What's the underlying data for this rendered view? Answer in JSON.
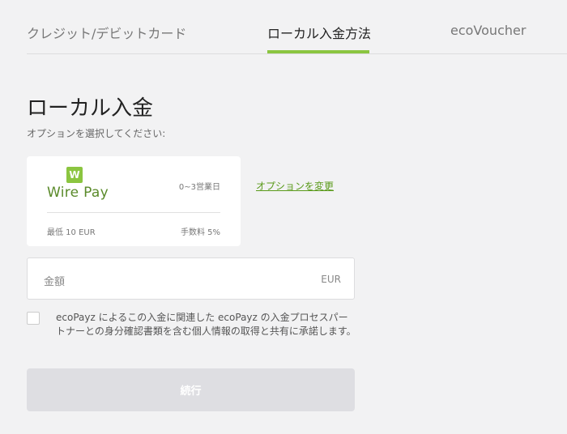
{
  "tabs": [
    {
      "label": "クレジット/デビットカード"
    },
    {
      "label": "ローカル入金方法"
    },
    {
      "label": "ecoVoucher"
    }
  ],
  "page": {
    "title": "ローカル入金",
    "subtitle": "オプションを選択してください:"
  },
  "option_card": {
    "logo_icon": "W",
    "logo_text": "Wire Pay",
    "days": "0~3営業日",
    "min": "最低 10 EUR",
    "fee": "手数料 5%"
  },
  "change_option_link": "オプションを変更",
  "amount": {
    "placeholder": "金額",
    "currency": "EUR"
  },
  "consent_text": "ecoPayz によるこの入金に関連した ecoPayz の入金プロセスパートナーとの身分確認書類を含む個人情報の取得と共有に承諾します。",
  "continue_label": "続行",
  "colors": {
    "accent": "#8bc540",
    "link": "#5a9a1a",
    "button_disabled": "#dedee2",
    "background": "#f2f2f3"
  }
}
